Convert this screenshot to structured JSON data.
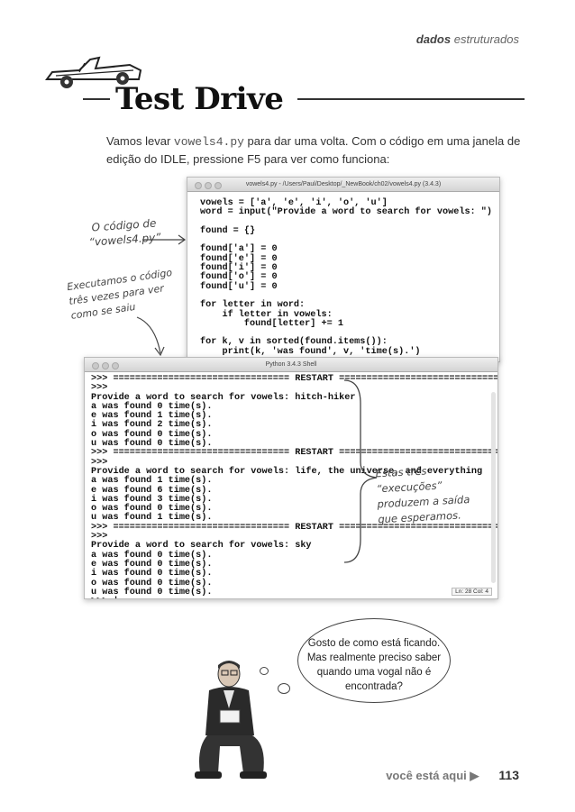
{
  "header": {
    "section_bold": "dados",
    "section_light": "estruturados"
  },
  "title": "Test Drive",
  "intro": {
    "before": "Vamos levar ",
    "filename": "vowels4.py",
    "after": " para dar uma volta. Com o código em uma janela de edição do IDLE, pressione F5 para ver como funciona:"
  },
  "notes": {
    "code_note": "O código de “vowels4.py”",
    "run_note": "Executamos o código três vezes para ver como se saiu",
    "output_note": "Estas três “execuções” produzem a saída que esperamos."
  },
  "editor": {
    "title": "vowels4.py - /Users/Paul/Desktop/_NewBook/ch02/vowels4.py (3.4.3)",
    "code": "vowels = ['a', 'e', 'i', 'o', 'u']\nword = input(\"Provide a word to search for vowels: \")\n\nfound = {}\n\nfound['a'] = 0\nfound['e'] = 0\nfound['i'] = 0\nfound['o'] = 0\nfound['u'] = 0\n\nfor letter in word:\n    if letter in vowels:\n        found[letter] += 1\n\nfor k, v in sorted(found.items()):\n    print(k, 'was found', v, 'time(s).')"
  },
  "shell": {
    "title": "Python 3.4.3 Shell",
    "output": ">>> ================================ RESTART ================================\n>>>\nProvide a word to search for vowels: hitch-hiker\na was found 0 time(s).\ne was found 1 time(s).\ni was found 2 time(s).\no was found 0 time(s).\nu was found 0 time(s).\n>>> ================================ RESTART ================================\n>>>\nProvide a word to search for vowels: life, the universe, and everything\na was found 1 time(s).\ne was found 6 time(s).\ni was found 3 time(s).\no was found 0 time(s).\nu was found 1 time(s).\n>>> ================================ RESTART ================================\n>>>\nProvide a word to search for vowels: sky\na was found 0 time(s).\ne was found 0 time(s).\ni was found 0 time(s).\no was found 0 time(s).\nu was found 0 time(s).\n>>> |",
    "status": "Ln: 28 Col: 4"
  },
  "bubble": {
    "text": "Gosto de como está ficando. Mas realmente preciso saber quando uma vogal não é encontrada?"
  },
  "footer": {
    "here": "você está aqui ▶",
    "page_number": "113"
  },
  "icons": [
    "car-icon",
    "person-illustration",
    "arrow-icon",
    "brace-icon"
  ]
}
